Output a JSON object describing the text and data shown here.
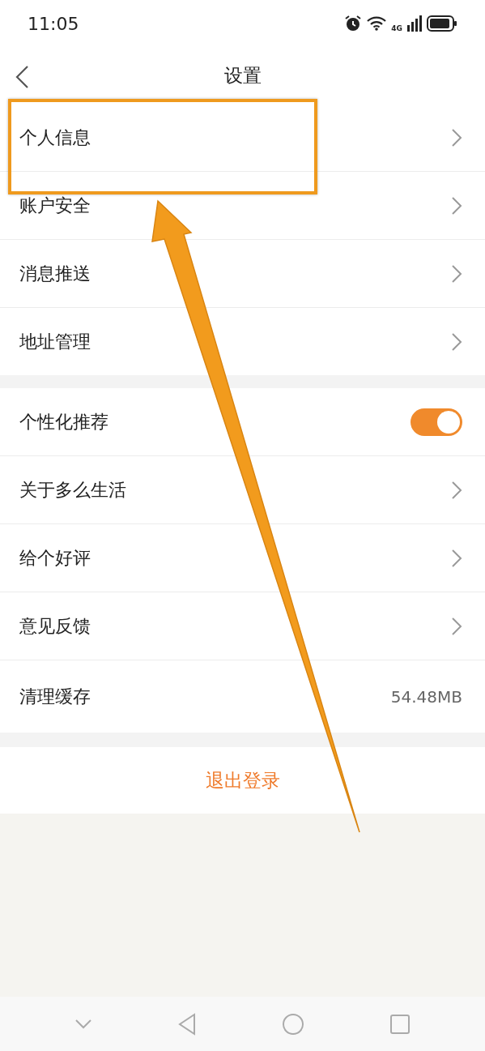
{
  "status_bar": {
    "time": "11:05",
    "network": "4G"
  },
  "header": {
    "title": "设置"
  },
  "groups": [
    {
      "rows": [
        {
          "kind": "link",
          "label": "个人信息",
          "highlighted": true
        },
        {
          "kind": "link",
          "label": "账户安全"
        },
        {
          "kind": "link",
          "label": "消息推送"
        },
        {
          "kind": "link",
          "label": "地址管理"
        }
      ]
    },
    {
      "rows": [
        {
          "kind": "toggle",
          "label": "个性化推荐",
          "on": true
        },
        {
          "kind": "link",
          "label": "关于多么生活"
        },
        {
          "kind": "link",
          "label": "给个好评"
        },
        {
          "kind": "link",
          "label": "意见反馈"
        },
        {
          "kind": "value",
          "label": "清理缓存",
          "value": "54.48MB"
        }
      ]
    }
  ],
  "logout": {
    "label": "退出登录"
  }
}
